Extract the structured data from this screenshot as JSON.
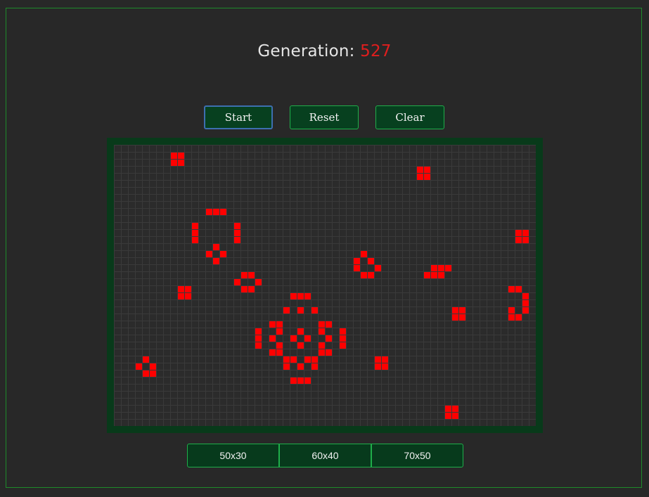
{
  "header": {
    "generation_label": "Generation:",
    "generation_count": "527",
    "accent_color": "#e01e1e"
  },
  "controls": {
    "start_label": "Start",
    "reset_label": "Reset",
    "clear_label": "Clear"
  },
  "board": {
    "columns": 60,
    "rows": 40,
    "live_color": "#ff0000",
    "live_cells": [
      [
        8,
        1
      ],
      [
        9,
        1
      ],
      [
        8,
        2
      ],
      [
        9,
        2
      ],
      [
        43,
        3
      ],
      [
        44,
        3
      ],
      [
        43,
        4
      ],
      [
        44,
        4
      ],
      [
        13,
        9
      ],
      [
        14,
        9
      ],
      [
        15,
        9
      ],
      [
        11,
        11
      ],
      [
        17,
        11
      ],
      [
        11,
        12
      ],
      [
        17,
        12
      ],
      [
        11,
        13
      ],
      [
        17,
        13
      ],
      [
        14,
        14
      ],
      [
        13,
        15
      ],
      [
        15,
        15
      ],
      [
        14,
        16
      ],
      [
        57,
        12
      ],
      [
        58,
        12
      ],
      [
        57,
        13
      ],
      [
        58,
        13
      ],
      [
        35,
        15
      ],
      [
        34,
        16
      ],
      [
        36,
        16
      ],
      [
        34,
        17
      ],
      [
        37,
        17
      ],
      [
        35,
        18
      ],
      [
        36,
        18
      ],
      [
        45,
        17
      ],
      [
        46,
        17
      ],
      [
        47,
        17
      ],
      [
        44,
        18
      ],
      [
        45,
        18
      ],
      [
        46,
        18
      ],
      [
        18,
        18
      ],
      [
        19,
        18
      ],
      [
        17,
        19
      ],
      [
        20,
        19
      ],
      [
        18,
        20
      ],
      [
        19,
        20
      ],
      [
        9,
        20
      ],
      [
        10,
        20
      ],
      [
        9,
        21
      ],
      [
        10,
        21
      ],
      [
        56,
        20
      ],
      [
        57,
        20
      ],
      [
        58,
        21
      ],
      [
        58,
        22
      ],
      [
        56,
        23
      ],
      [
        58,
        23
      ],
      [
        56,
        24
      ],
      [
        57,
        24
      ],
      [
        25,
        21
      ],
      [
        26,
        21
      ],
      [
        27,
        21
      ],
      [
        24,
        23
      ],
      [
        26,
        23
      ],
      [
        28,
        23
      ],
      [
        22,
        25
      ],
      [
        23,
        25
      ],
      [
        29,
        25
      ],
      [
        30,
        25
      ],
      [
        23,
        26
      ],
      [
        26,
        26
      ],
      [
        29,
        26
      ],
      [
        20,
        26
      ],
      [
        32,
        26
      ],
      [
        20,
        27
      ],
      [
        22,
        27
      ],
      [
        25,
        27
      ],
      [
        27,
        27
      ],
      [
        30,
        27
      ],
      [
        32,
        27
      ],
      [
        20,
        28
      ],
      [
        26,
        28
      ],
      [
        32,
        28
      ],
      [
        23,
        28
      ],
      [
        29,
        28
      ],
      [
        22,
        29
      ],
      [
        23,
        29
      ],
      [
        29,
        29
      ],
      [
        30,
        29
      ],
      [
        48,
        23
      ],
      [
        49,
        23
      ],
      [
        48,
        24
      ],
      [
        49,
        24
      ],
      [
        24,
        30
      ],
      [
        25,
        30
      ],
      [
        27,
        30
      ],
      [
        28,
        30
      ],
      [
        24,
        31
      ],
      [
        26,
        31
      ],
      [
        28,
        31
      ],
      [
        25,
        33
      ],
      [
        26,
        33
      ],
      [
        27,
        33
      ],
      [
        4,
        30
      ],
      [
        3,
        31
      ],
      [
        5,
        31
      ],
      [
        4,
        32
      ],
      [
        5,
        32
      ],
      [
        37,
        30
      ],
      [
        38,
        30
      ],
      [
        37,
        31
      ],
      [
        38,
        31
      ],
      [
        47,
        37
      ],
      [
        48,
        37
      ],
      [
        47,
        38
      ],
      [
        48,
        38
      ]
    ]
  },
  "sizes": {
    "options": [
      "50x30",
      "60x40",
      "70x50"
    ]
  }
}
